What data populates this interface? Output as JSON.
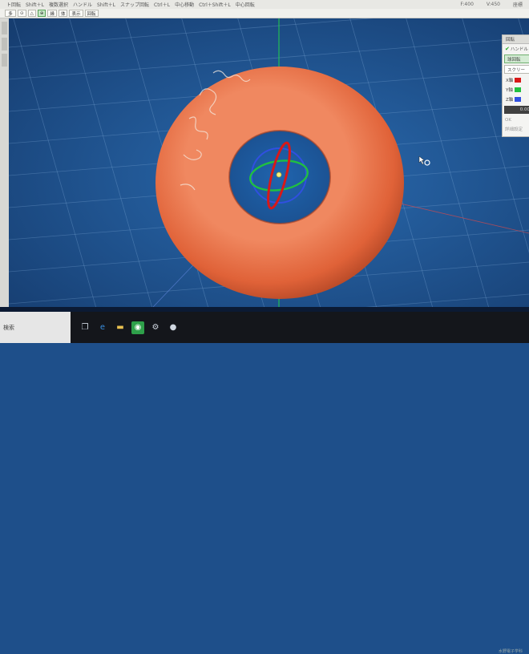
{
  "topbar": {
    "items": [
      "ト回転",
      "Shift＋L",
      "複数選択",
      "ハンドル",
      "Shift＋L",
      "スナップ回転",
      "Ctrl＋L",
      "中心移動",
      "Ctrl＋Shift＋L",
      "中心回転"
    ],
    "right": [
      "F:400",
      "V:450",
      "座標"
    ]
  },
  "toolbar": {
    "buttons": [
      {
        "label": "多",
        "active": false
      },
      {
        "label": "⊙",
        "active": false
      },
      {
        "label": "△",
        "active": false
      },
      {
        "label": "⊕",
        "active": true
      },
      {
        "label": "縁",
        "active": false
      },
      {
        "label": "体",
        "active": false
      },
      {
        "label": "表示",
        "active": false
      },
      {
        "label": "回転",
        "active": false
      }
    ]
  },
  "panel": {
    "title": "回転",
    "handle_label": "ハンドル",
    "primary_button": "球回転",
    "secondary_button": "スクリー",
    "axis_x": "X軸",
    "axis_y": "Y軸",
    "axis_z": "Z軸",
    "value": "0.00",
    "ok": "OK",
    "detail": "詳細設定"
  },
  "taskbar": {
    "search_label": "検索",
    "tray_text": "水野電子学科"
  },
  "colors": {
    "viewport_bg": "#1e4f8a",
    "donut": "#e86c42",
    "x_axis": "#d81818",
    "y_axis": "#20c040",
    "z_axis": "#3050e0"
  }
}
